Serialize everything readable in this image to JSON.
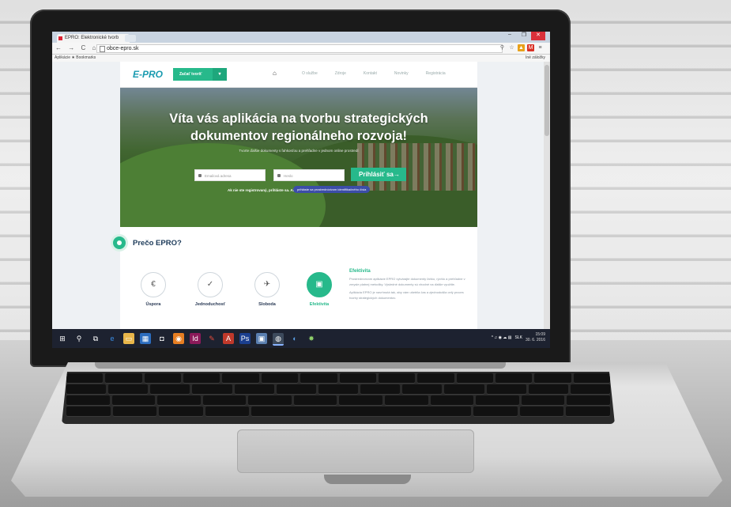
{
  "browser": {
    "tab_title": "EPRO: Elektronické tvorb",
    "url": "obce-epro.sk",
    "bookmarks": {
      "apps": "Aplikácie",
      "bookmark": "Bookmarks",
      "other": "Iné záložky"
    },
    "window_controls": {
      "minimize": "–",
      "maximize": "❐",
      "close": "✕"
    }
  },
  "site": {
    "logo": "E-PRO",
    "cta_label": "Začať tvoriť",
    "menu": [
      "O službe",
      "Zdroje",
      "Kontakt",
      "Novinky",
      "Registrácia"
    ],
    "hero": {
      "title": "Víta vás aplikácia na tvorbu strategických dokumentov regionálneho rozvoja!",
      "subtitle": "Tvorte ďalšie dokumenty s ľahkosťou a prehľadne v jednom online prostredí",
      "email_placeholder": "Emailová adresa",
      "password_placeholder": "Heslo",
      "login_label": "Prihlásiť sa",
      "register_text": "Ak nie ste registrovaný, prihláste sa. Ak ste",
      "id_button": "prihláste sa prostredníctvom identifikačného čísla"
    },
    "why": {
      "title": "Prečo EPRO?"
    },
    "features": [
      {
        "icon": "€",
        "label": "Úspora"
      },
      {
        "icon": "✓",
        "label": "Jednoduchosť"
      },
      {
        "icon": "✈",
        "label": "Sloboda"
      },
      {
        "icon": "▣",
        "label": "Efektivita"
      }
    ],
    "efektivita": {
      "heading": "Efektivita",
      "p1": "Prostredníctvom aplikácie EPRO vytvárajte dokumenty ľahko, rýchlo a prehľadne v zmysle platnej metodiky. Výsledné dokumenty sú vhodné na ďalšie využitie.",
      "p2": "Aplikácia EPRO je navrhnutá tak, aby vám ušetrila čas a zjednodušila celý proces tvorby strategických dokumentov."
    }
  },
  "taskbar": {
    "language": "SLK",
    "time": "15:09",
    "date": "30. 6. 2016"
  }
}
